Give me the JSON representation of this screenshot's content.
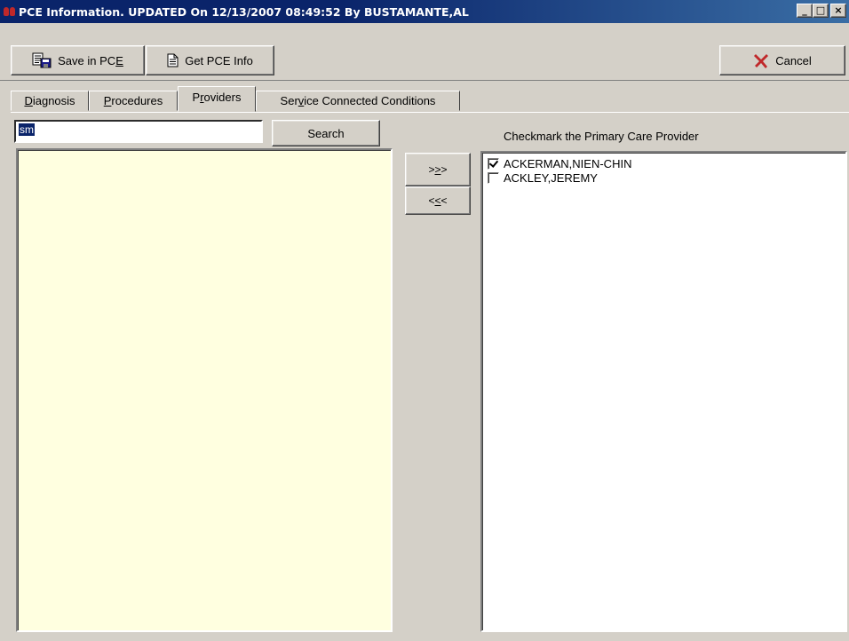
{
  "window": {
    "title": "PCE Information.  UPDATED On 12/13/2007 08:49:52 By BUSTAMANTE,AL",
    "minimize_label": "_",
    "maximize_label": "□",
    "close_label": "×"
  },
  "toolbar": {
    "save_label": "Save in PC",
    "save_mnemonic": "E",
    "get_info_label": "Get PCE Info",
    "cancel_label": "Cancel"
  },
  "tabs": [
    {
      "prefix": "",
      "mnemonic": "D",
      "rest": "iagnosis"
    },
    {
      "prefix": "",
      "mnemonic": "P",
      "rest": "rocedures"
    },
    {
      "prefix": "P",
      "mnemonic": "r",
      "rest": "oviders"
    },
    {
      "prefix": "Ser",
      "mnemonic": "v",
      "rest": "ice Connected Conditions"
    }
  ],
  "active_tab": "Providers",
  "search": {
    "value": "sm",
    "button_label": "Search"
  },
  "transfer": {
    "add_label": ">>>",
    "remove_label": "<<<"
  },
  "instruction": "Checkmark the Primary Care Provider",
  "providers": [
    {
      "name": "ACKERMAN,NIEN-CHIN",
      "primary": true
    },
    {
      "name": "ACKLEY,JEREMY",
      "primary": false
    }
  ],
  "colors": {
    "title_bar": "#0a246a",
    "window_bg": "#d4d0c8",
    "results_bg": "#ffffe0",
    "cancel_x": "#c0282a"
  }
}
